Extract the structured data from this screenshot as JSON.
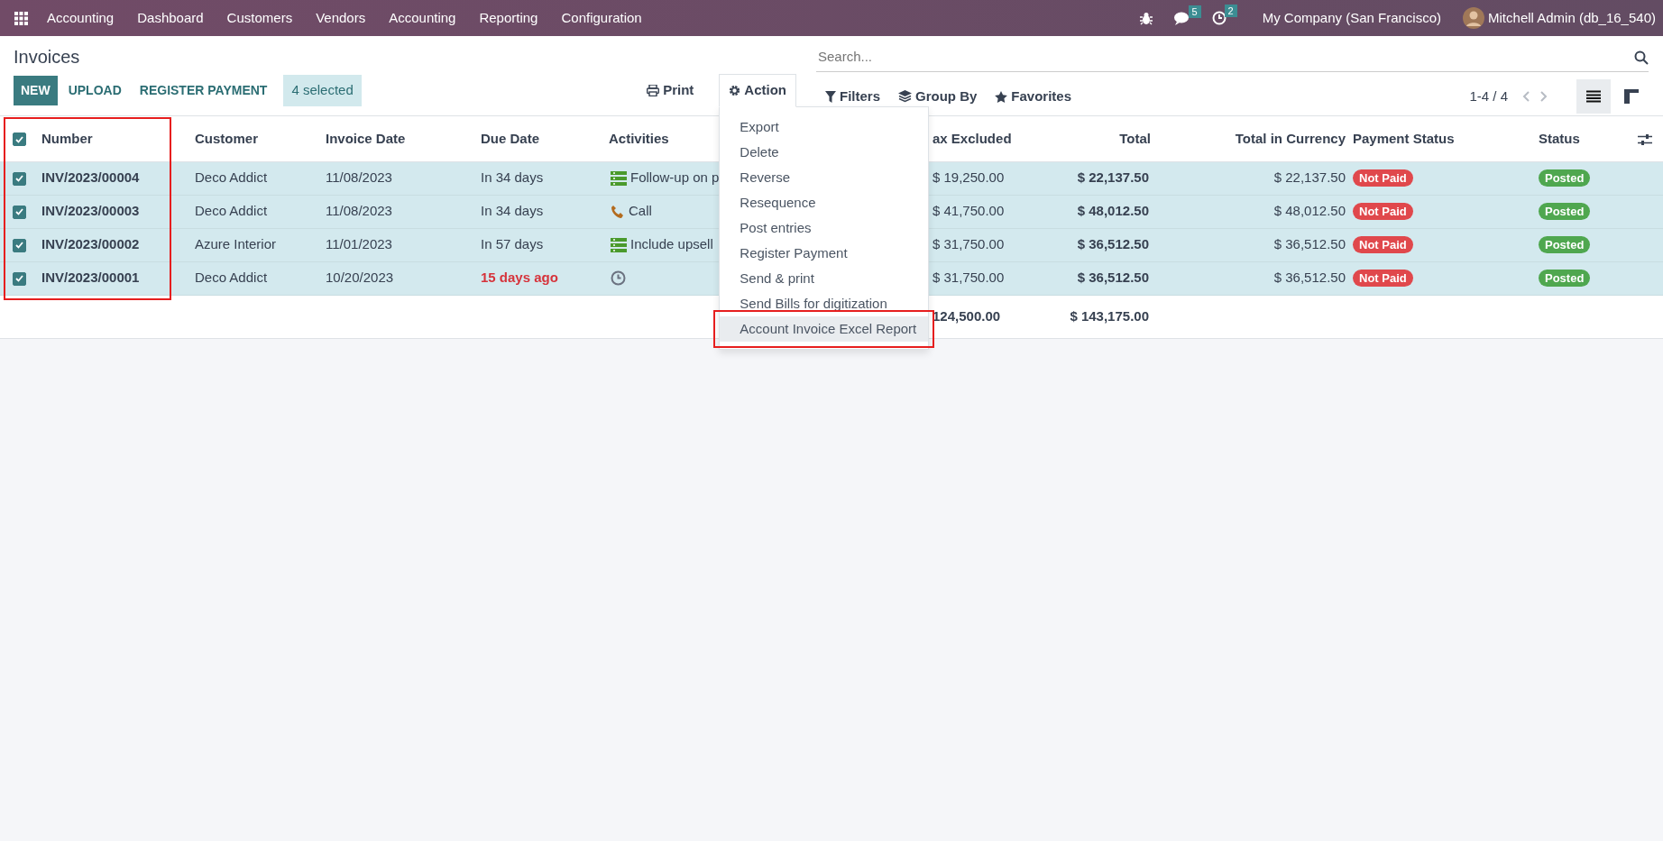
{
  "navbar": {
    "app": "Accounting",
    "menus": [
      "Dashboard",
      "Customers",
      "Vendors",
      "Accounting",
      "Reporting",
      "Configuration"
    ],
    "messages_count": "5",
    "activities_count": "2",
    "company": "My Company (San Francisco)",
    "user": "Mitchell Admin (db_16_540)"
  },
  "control_panel": {
    "title": "Invoices",
    "buttons": [
      {
        "label": "NEW",
        "kind": "primary"
      },
      {
        "label": "UPLOAD",
        "kind": "link"
      },
      {
        "label": "REGISTER PAYMENT",
        "kind": "link"
      }
    ],
    "selection": "4 selected",
    "print": "Print",
    "action": {
      "label": "Action",
      "expanded": true
    },
    "search": {
      "placeholder": "Search..."
    },
    "filters": [
      {
        "label": "Filters",
        "kind": "filter"
      },
      {
        "label": "Group By",
        "kind": "group"
      },
      {
        "label": "Favorites",
        "kind": "favorite"
      }
    ],
    "pager": "1-4 / 4",
    "views": [
      {
        "kind": "list",
        "selected": true
      },
      {
        "kind": "kanban",
        "selected": false
      }
    ]
  },
  "action_menu": [
    {
      "label": "Export",
      "highlighted": false
    },
    {
      "label": "Delete",
      "highlighted": false
    },
    {
      "label": "Reverse",
      "highlighted": false
    },
    {
      "label": "Resequence",
      "highlighted": false
    },
    {
      "label": "Post entries",
      "highlighted": false
    },
    {
      "label": "Register Payment",
      "highlighted": false
    },
    {
      "label": "Send & print",
      "highlighted": false
    },
    {
      "label": "Send Bills for digitization",
      "highlighted": false
    },
    {
      "label": "Account Invoice Excel Report",
      "highlighted": true
    }
  ],
  "table": {
    "select_all": {
      "checked": true
    },
    "number_column_framed": true,
    "columns": [
      {
        "label": "Number"
      },
      {
        "label": "Customer"
      },
      {
        "label": "Invoice Date"
      },
      {
        "label": "Due Date"
      },
      {
        "label": "Activities"
      },
      {
        "label": "ax Excluded"
      },
      {
        "label": "Total"
      },
      {
        "label": "Total in Currency"
      },
      {
        "label": "Payment Status"
      },
      {
        "label": "Status"
      }
    ],
    "rows": [
      {
        "selected": true,
        "number": "INV/2023/00004",
        "customer": "Deco Addict",
        "invoice_date": "11/08/2023",
        "due_date": "In 34 days",
        "overdue": false,
        "activity": {
          "kind": "todo",
          "label": "Follow-up on p"
        },
        "tax_excluded": "$ 19,250.00",
        "total": "$ 22,137.50",
        "total_currency": "$ 22,137.50",
        "payment_status": "Not Paid",
        "paid": false,
        "status": "Posted",
        "posted": true
      },
      {
        "selected": true,
        "number": "INV/2023/00003",
        "customer": "Deco Addict",
        "invoice_date": "11/08/2023",
        "due_date": "In 34 days",
        "overdue": false,
        "activity": {
          "kind": "call",
          "label": "Call"
        },
        "tax_excluded": "$ 41,750.00",
        "total": "$ 48,012.50",
        "total_currency": "$ 48,012.50",
        "payment_status": "Not Paid",
        "paid": false,
        "status": "Posted",
        "posted": true
      },
      {
        "selected": true,
        "number": "INV/2023/00002",
        "customer": "Azure Interior",
        "invoice_date": "11/01/2023",
        "due_date": "In 57 days",
        "overdue": false,
        "activity": {
          "kind": "todo",
          "label": "Include upsell"
        },
        "tax_excluded": "$ 31,750.00",
        "total": "$ 36,512.50",
        "total_currency": "$ 36,512.50",
        "payment_status": "Not Paid",
        "paid": false,
        "status": "Posted",
        "posted": true
      },
      {
        "selected": true,
        "number": "INV/2023/00001",
        "customer": "Deco Addict",
        "invoice_date": "10/20/2023",
        "due_date": "15 days ago",
        "overdue": true,
        "activity": {
          "kind": "clock"
        },
        "tax_excluded": "$ 31,750.00",
        "total": "$ 36,512.50",
        "total_currency": "$ 36,512.50",
        "payment_status": "Not Paid",
        "paid": false,
        "status": "Posted",
        "posted": true
      }
    ],
    "totals": {
      "tax_excluded": "124,500.00",
      "total": "$ 143,175.00"
    }
  }
}
